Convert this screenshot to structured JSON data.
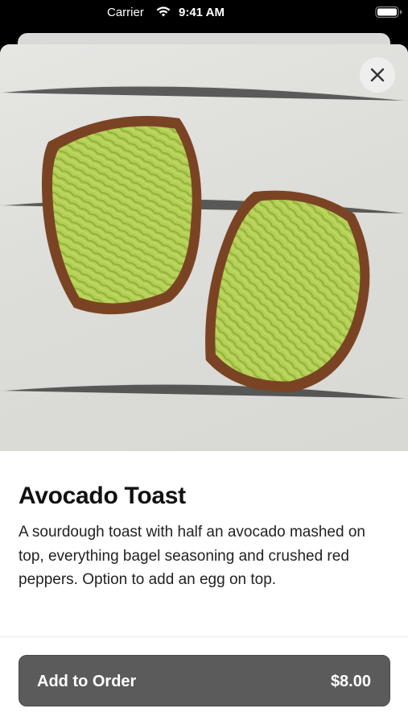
{
  "status_bar": {
    "carrier": "Carrier",
    "time": "9:41 AM"
  },
  "product": {
    "title": "Avocado Toast",
    "description": "A sourdough toast with half an avocado mashed on top, everything bagel seasoning and crushed red peppers. Option to add an egg on top.",
    "image_icon": "avocado-toast-photo"
  },
  "actions": {
    "add_label": "Add to Order",
    "price": "$8.00",
    "close_icon": "close-icon"
  },
  "colors": {
    "button_bg": "#5b5b5b",
    "avocado": "#a8c64a",
    "bread": "#7a4424"
  }
}
